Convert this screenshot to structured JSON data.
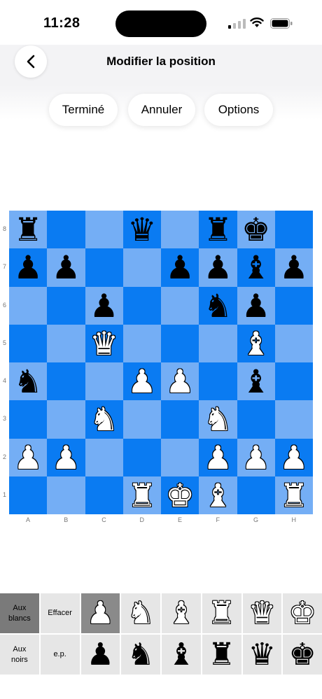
{
  "status": {
    "time": "11:28"
  },
  "nav": {
    "title": "Modifier la position"
  },
  "actions": {
    "done": "Terminé",
    "cancel": "Annuler",
    "options": "Options"
  },
  "board": {
    "colors": {
      "light": "#74aef5",
      "dark": "#0a7bf2"
    },
    "ranks": [
      "8",
      "7",
      "6",
      "5",
      "4",
      "3",
      "2",
      "1"
    ],
    "files": [
      "A",
      "B",
      "C",
      "D",
      "E",
      "F",
      "G",
      "H"
    ],
    "position": [
      [
        "br",
        "",
        "",
        "bq",
        "",
        "br",
        "bk",
        ""
      ],
      [
        "bp",
        "bp",
        "",
        "",
        "bp",
        "bp",
        "bb",
        "bp"
      ],
      [
        "",
        "",
        "bp",
        "",
        "",
        "bn",
        "bp",
        ""
      ],
      [
        "",
        "",
        "wq",
        "",
        "",
        "",
        "wb",
        ""
      ],
      [
        "bn",
        "",
        "",
        "wp",
        "wp",
        "",
        "bb",
        ""
      ],
      [
        "",
        "",
        "wn",
        "",
        "",
        "wn",
        "",
        ""
      ],
      [
        "wp",
        "wp",
        "",
        "",
        "",
        "wp",
        "wp",
        "wp"
      ],
      [
        "",
        "",
        "",
        "wr",
        "wk",
        "wb",
        "",
        "wr"
      ]
    ]
  },
  "palette": {
    "white_label": "Aux blancs",
    "clear_label": "Effacer",
    "black_label": "Aux noirs",
    "ep_label": "e.p.",
    "white_pieces": [
      "wp",
      "wn",
      "wb",
      "wr",
      "wq",
      "wk"
    ],
    "black_pieces": [
      "bp",
      "bn",
      "bb",
      "br",
      "bq",
      "bk"
    ]
  }
}
